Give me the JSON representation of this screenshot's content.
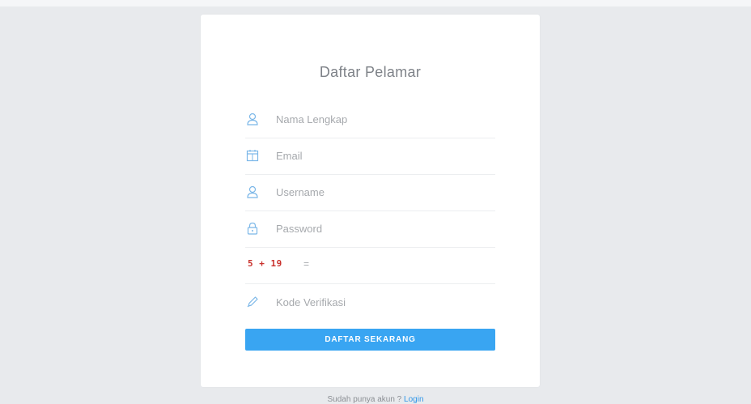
{
  "form": {
    "title": "Daftar Pelamar",
    "fields": [
      {
        "icon": "user-icon",
        "placeholder": "Nama Lengkap"
      },
      {
        "icon": "calendar-icon",
        "placeholder": "Email"
      },
      {
        "icon": "user-icon",
        "placeholder": "Username"
      },
      {
        "icon": "lock-icon",
        "placeholder": "Password"
      }
    ],
    "captcha": {
      "expression": "5 + 19",
      "equals": "="
    },
    "verification": {
      "icon": "pencil-icon",
      "placeholder": "Kode Verifikasi"
    },
    "submit_label": "DAFTAR SEKARANG"
  },
  "footer": {
    "prompt": "Sudah punya akun ?",
    "login_label": "Login"
  },
  "colors": {
    "background": "#e8eaed",
    "card": "#ffffff",
    "accent": "#39a5f2",
    "captcha_text": "#c9302c",
    "icon": "#7bb7e8",
    "link": "#2f96e8"
  }
}
